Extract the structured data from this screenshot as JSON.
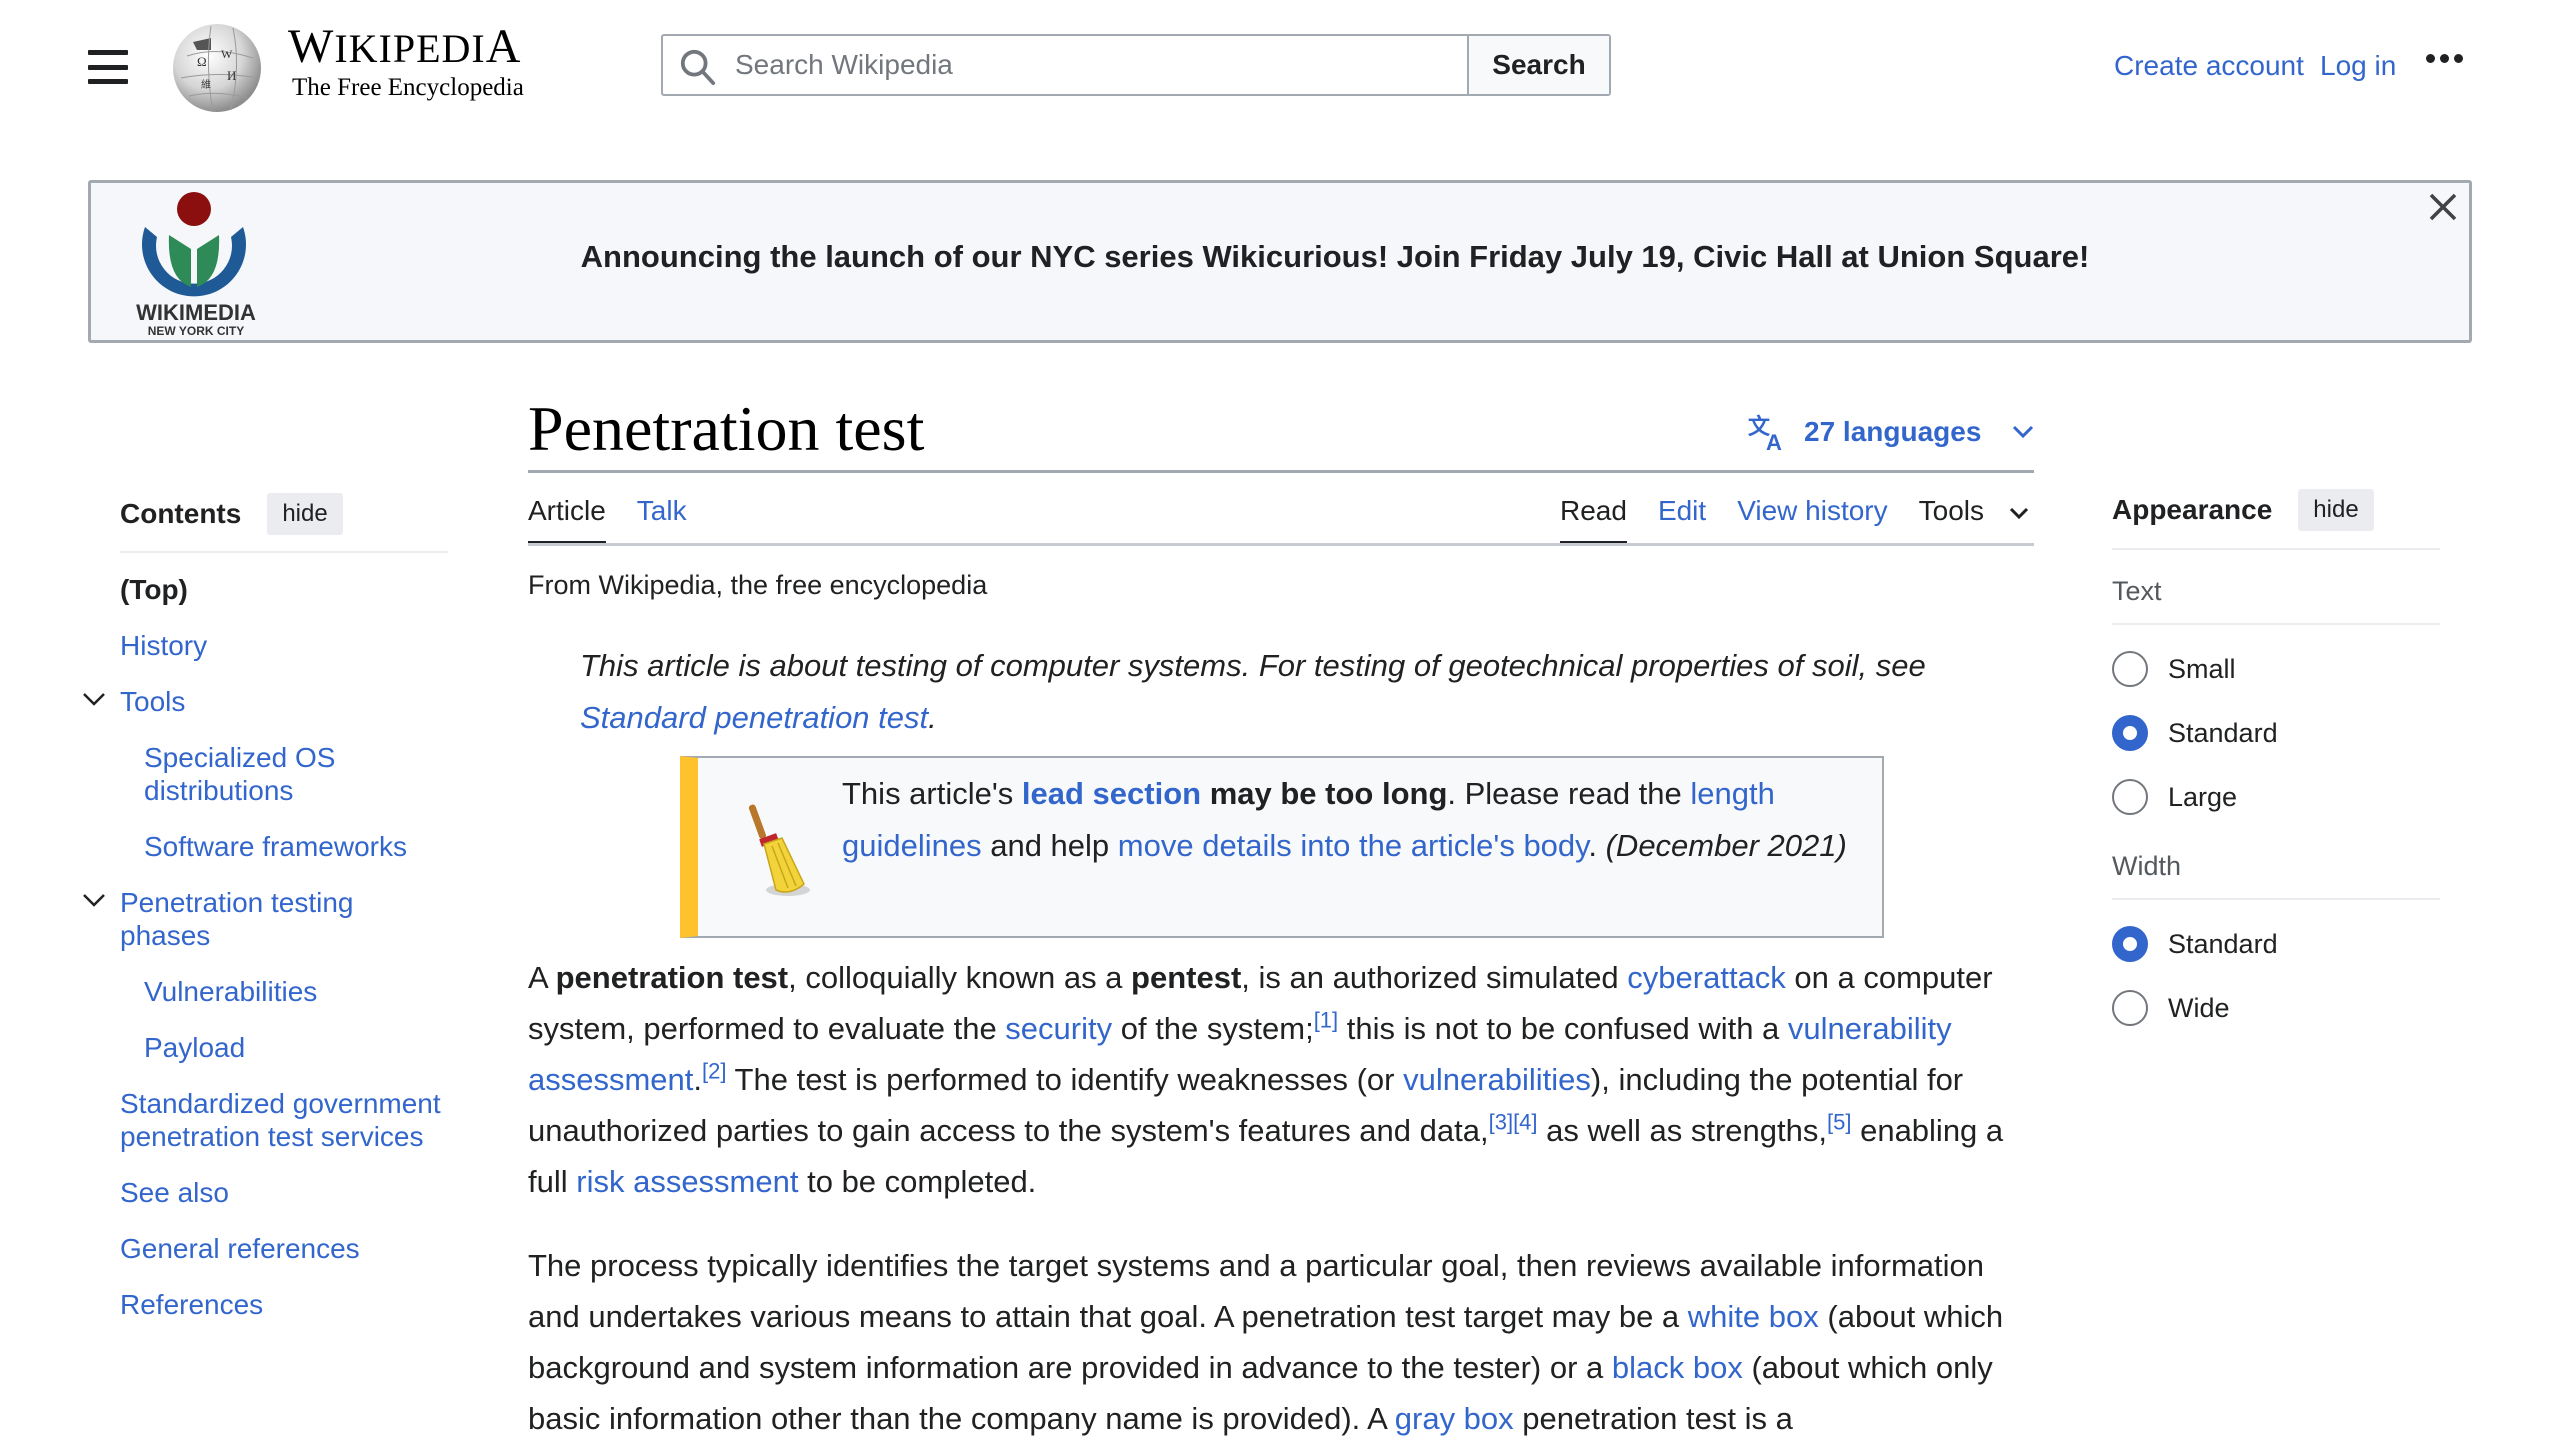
{
  "header": {
    "menu_icon": "hamburger-menu-icon",
    "logo_wordmark": "Wikipedia",
    "logo_tagline": "The Free Encyclopedia",
    "search_placeholder": "Search Wikipedia",
    "search_value": "",
    "search_button": "Search",
    "create_account": "Create account",
    "log_in": "Log in",
    "more_icon": "ellipsis-icon"
  },
  "banner": {
    "logo_text": "WIKIMEDIA",
    "logo_subtext": "NEW YORK CITY",
    "message": "Announcing the launch of our NYC series Wikicurious! Join Friday July 19, Civic Hall at Union Square!",
    "close_icon": "close-icon"
  },
  "toc": {
    "title": "Contents",
    "hide": "hide",
    "items": [
      {
        "label": "(Top)",
        "level": 1,
        "current": true
      },
      {
        "label": "History",
        "level": 1
      },
      {
        "label": "Tools",
        "level": 1,
        "expanded": true
      },
      {
        "label": "Specialized OS distributions",
        "level": 2
      },
      {
        "label": "Software frameworks",
        "level": 2
      },
      {
        "label": "Penetration testing phases",
        "level": 1,
        "expanded": true
      },
      {
        "label": "Vulnerabilities",
        "level": 2
      },
      {
        "label": "Payload",
        "level": 2
      },
      {
        "label": "Standardized government penetration test services",
        "level": 1
      },
      {
        "label": "See also",
        "level": 1
      },
      {
        "label": "General references",
        "level": 1
      },
      {
        "label": "References",
        "level": 1
      }
    ]
  },
  "article": {
    "title": "Penetration test",
    "languages": "27 languages",
    "tabs_left": [
      {
        "label": "Article",
        "selected": true
      },
      {
        "label": "Talk"
      }
    ],
    "tabs_right": [
      {
        "label": "Read",
        "selected": true
      },
      {
        "label": "Edit"
      },
      {
        "label": "View history"
      },
      {
        "label": "Tools"
      }
    ],
    "tagline": "From Wikipedia, the free encyclopedia",
    "hatnote": {
      "text": "This article is about testing of computer systems. For testing of geotechnical properties of soil, see ",
      "link": "Standard penetration test",
      "end": "."
    },
    "ambox": {
      "t1": "This article's ",
      "link1": "lead section",
      "bold": " may be too long",
      "t2": ". Please read the ",
      "link2": "length guidelines",
      "t3": " and help ",
      "link3": "move details into the article's body",
      "t4": ". ",
      "date": "(December 2021)"
    },
    "p1": {
      "a": "A ",
      "b1": "penetration test",
      "c": ", colloquially known as a ",
      "b2": "pentest",
      "d": ", is an authorized simulated ",
      "l1": "cyberattack",
      "e": " on a computer system, performed to evaluate the ",
      "l2": "security",
      "f": " of the system;",
      "r1": "[1]",
      "g": " this is not to be confused with a ",
      "l3": "vulnerability assessment",
      "h": ".",
      "r2": "[2]",
      "i": " The test is performed to identify weaknesses (or ",
      "l4": "vulnerabilities",
      "j": "), including the potential for unauthorized parties to gain access to the system's features and data,",
      "r3": "[3]",
      "r4": "[4]",
      "k": " as well as strengths,",
      "r5": "[5]",
      "m": " enabling a full ",
      "l5": "risk assessment",
      "n": " to be completed."
    },
    "p2": {
      "a": "The process typically identifies the target systems and a particular goal, then reviews available information and undertakes various means to attain that goal. A penetration test target may be a ",
      "l1": "white box",
      "b": " (about which background and system information are provided in advance to the tester) or a ",
      "l2": "black box",
      "c": " (about which only basic information other than the company name is provided). A ",
      "l3": "gray box",
      "d": " penetration test is a"
    }
  },
  "appearance": {
    "title": "Appearance",
    "hide": "hide",
    "text_label": "Text",
    "text_options": [
      {
        "label": "Small",
        "checked": false
      },
      {
        "label": "Standard",
        "checked": true
      },
      {
        "label": "Large",
        "checked": false
      }
    ],
    "width_label": "Width",
    "width_options": [
      {
        "label": "Standard",
        "checked": true
      },
      {
        "label": "Wide",
        "checked": false
      }
    ]
  },
  "colors": {
    "link": "#3366cc",
    "text": "#202122",
    "ambox_accent": "#fec22e",
    "banner_bg": "#f5f7fa"
  }
}
